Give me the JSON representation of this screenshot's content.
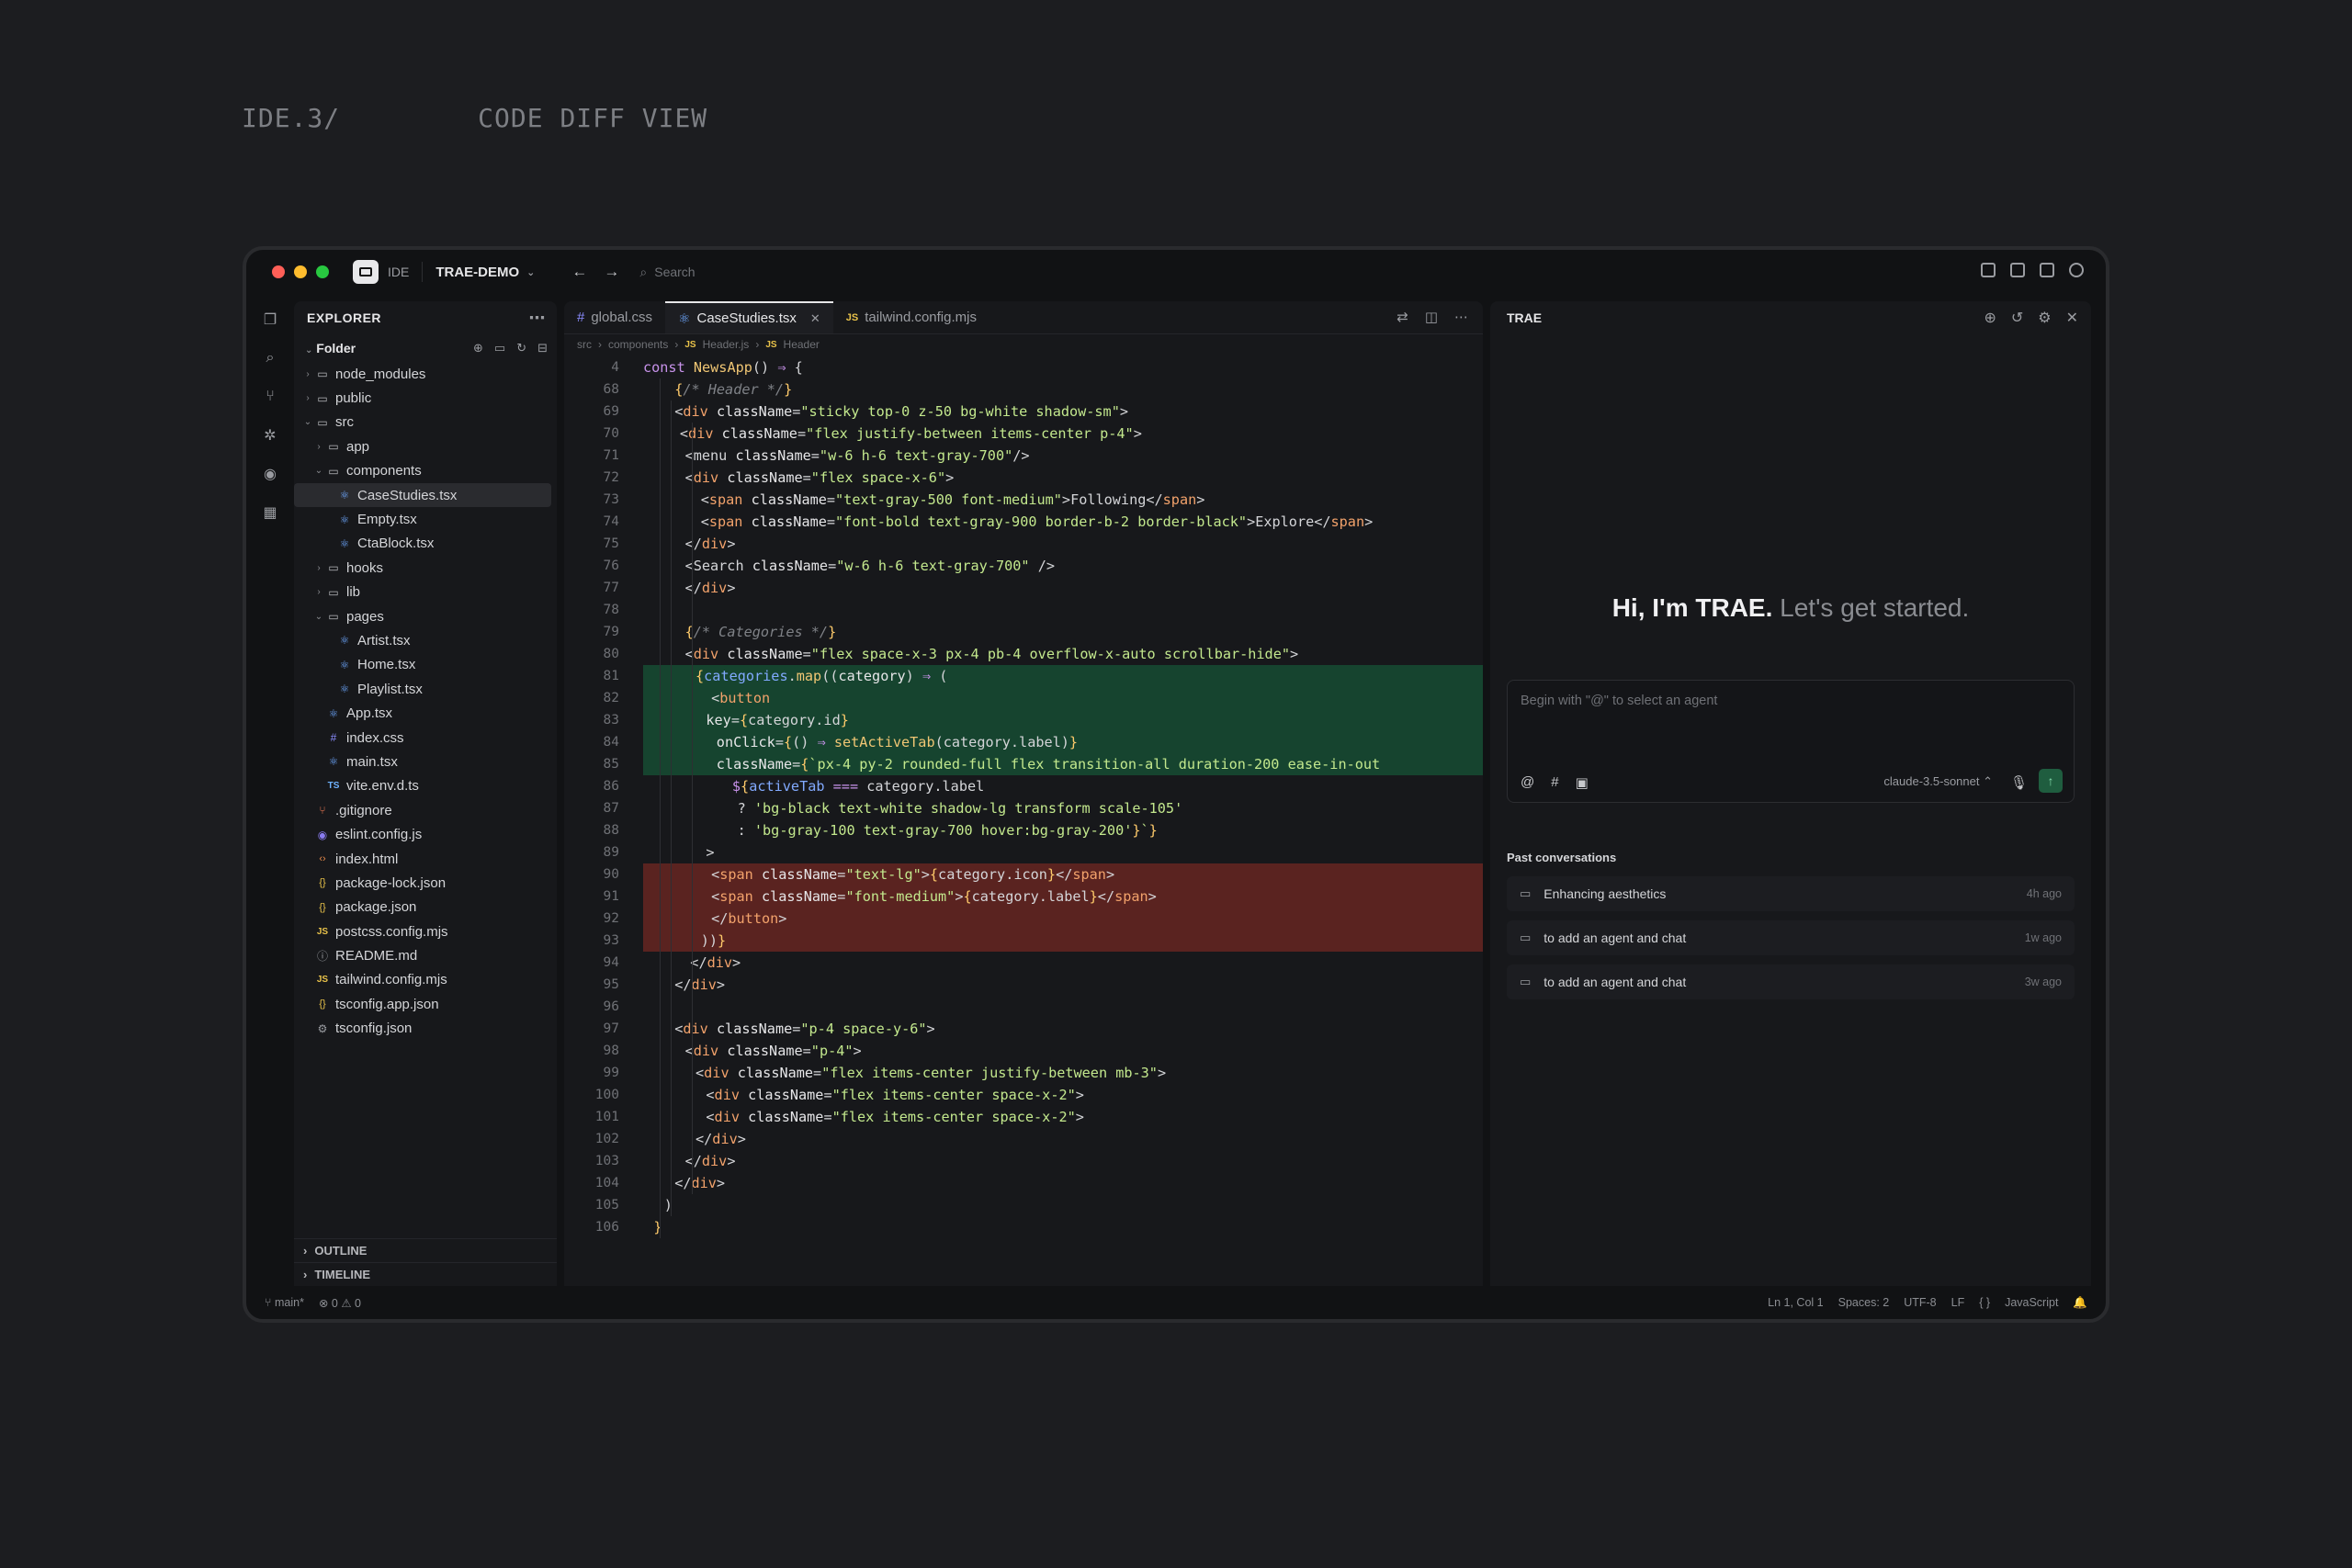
{
  "heading": {
    "label": "IDE.3/",
    "title": "CODE DIFF VIEW"
  },
  "titlebar": {
    "app_badge": "IDE",
    "project": "TRAE-DEMO",
    "search_placeholder": "Search"
  },
  "explorer": {
    "title": "EXPLORER",
    "root": "Folder",
    "items": [
      {
        "name": "node_modules",
        "type": "folder",
        "depth": 0,
        "open": false
      },
      {
        "name": "public",
        "type": "folder",
        "depth": 0,
        "open": false
      },
      {
        "name": "src",
        "type": "folder",
        "depth": 0,
        "open": true
      },
      {
        "name": "app",
        "type": "folder",
        "depth": 1,
        "open": false
      },
      {
        "name": "components",
        "type": "folder",
        "depth": 1,
        "open": true
      },
      {
        "name": "CaseStudies.tsx",
        "type": "react",
        "depth": 2,
        "selected": true
      },
      {
        "name": "Empty.tsx",
        "type": "react",
        "depth": 2
      },
      {
        "name": "CtaBlock.tsx",
        "type": "react",
        "depth": 2
      },
      {
        "name": "hooks",
        "type": "folder",
        "depth": 1,
        "open": false
      },
      {
        "name": "lib",
        "type": "folder",
        "depth": 1,
        "open": false
      },
      {
        "name": "pages",
        "type": "folder",
        "depth": 1,
        "open": true
      },
      {
        "name": "Artist.tsx",
        "type": "react",
        "depth": 2
      },
      {
        "name": "Home.tsx",
        "type": "react",
        "depth": 2
      },
      {
        "name": "Playlist.tsx",
        "type": "react",
        "depth": 2
      },
      {
        "name": "App.tsx",
        "type": "react",
        "depth": 1
      },
      {
        "name": "index.css",
        "type": "css",
        "depth": 1
      },
      {
        "name": "main.tsx",
        "type": "react",
        "depth": 1
      },
      {
        "name": "vite.env.d.ts",
        "type": "ts",
        "depth": 1
      },
      {
        "name": ".gitignore",
        "type": "git",
        "depth": 0
      },
      {
        "name": "eslint.config.js",
        "type": "eslint",
        "depth": 0
      },
      {
        "name": "index.html",
        "type": "html",
        "depth": 0
      },
      {
        "name": "package-lock.json",
        "type": "json",
        "depth": 0
      },
      {
        "name": "package.json",
        "type": "json",
        "depth": 0
      },
      {
        "name": "postcss.config.mjs",
        "type": "js",
        "depth": 0
      },
      {
        "name": "README.md",
        "type": "info",
        "depth": 0
      },
      {
        "name": "tailwind.config.mjs",
        "type": "js",
        "depth": 0
      },
      {
        "name": "tsconfig.app.json",
        "type": "json",
        "depth": 0
      },
      {
        "name": "tsconfig.json",
        "type": "gear",
        "depth": 0
      }
    ],
    "outline": "OUTLINE",
    "timeline": "TIMELINE"
  },
  "editor": {
    "tabs": [
      {
        "label": "global.css",
        "icon": "#",
        "active": false
      },
      {
        "label": "CaseStudies.tsx",
        "icon": "react",
        "active": true
      },
      {
        "label": "tailwind.config.mjs",
        "icon": "JS",
        "active": false
      }
    ],
    "breadcrumbs": [
      "src",
      "components",
      "Header.js",
      "Header"
    ],
    "lines": [
      {
        "n": "4",
        "html": "<span class='k'>const</span> <span class='f'>NewsApp</span><span class='p'>() </span><span class='k'>⇒</span> <span class='p'>{</span>",
        "indent": 0
      },
      {
        "n": "68",
        "html": "<span class='br'>{</span><span class='c'>/* Header */</span><span class='br'>}</span>",
        "indent": 3
      },
      {
        "n": "69",
        "html": "<span class='p'>&lt;</span><span class='t'>div</span> <span class='a'>className</span><span class='p'>=</span><span class='s'>\"sticky top-0 z-50 bg-white shadow-sm\"</span><span class='p'>&gt;</span>",
        "indent": 3
      },
      {
        "n": "70",
        "html": "<span class='p'>&lt;</span><span class='t'>div</span> <span class='a'>className</span><span class='p'>=</span><span class='s'>\"flex justify-between items-center p-4\"</span><span class='p'>&gt;</span>",
        "indent": 3.5
      },
      {
        "n": "71",
        "html": "<span class='p'>&lt;menu</span> <span class='a'>className</span><span class='p'>=</span><span class='s'>\"w-6 h-6 text-gray-700\"</span><span class='p'>/&gt;</span>",
        "indent": 4
      },
      {
        "n": "72",
        "html": "<span class='p'>&lt;</span><span class='t'>div</span> <span class='a'>className</span><span class='p'>=</span><span class='s'>\"flex space-x-6\"</span><span class='p'>&gt;</span>",
        "indent": 4
      },
      {
        "n": "73",
        "html": "<span class='p'>&lt;</span><span class='t'>span</span> <span class='a'>className</span><span class='p'>=</span><span class='s'>\"text-gray-500 font-medium\"</span><span class='p'>&gt;Following&lt;/</span><span class='t'>span</span><span class='p'>&gt;</span>",
        "indent": 5.5
      },
      {
        "n": "74",
        "html": "<span class='p'>&lt;</span><span class='t'>span</span> <span class='a'>className</span><span class='p'>=</span><span class='s'>\"font-bold text-gray-900 border-b-2 border-black\"</span><span class='p'>&gt;Explore&lt;/</span><span class='t'>span</span><span class='p'>&gt;</span>",
        "indent": 5.5
      },
      {
        "n": "75",
        "html": "<span class='p'>&lt;/</span><span class='t'>div</span><span class='p'>&gt;</span>",
        "indent": 4
      },
      {
        "n": "76",
        "html": "<span class='p'>&lt;Search</span> <span class='a'>className</span><span class='p'>=</span><span class='s'>\"w-6 h-6 text-gray-700\"</span> <span class='p'>/&gt;</span>",
        "indent": 4
      },
      {
        "n": "77",
        "html": "<span class='p'>&lt;/</span><span class='t'>div</span><span class='p'>&gt;</span>",
        "indent": 4
      },
      {
        "n": "78",
        "html": "",
        "indent": 0
      },
      {
        "n": "79",
        "html": "<span class='br'>{</span><span class='c'>/* Categories */</span><span class='br'>}</span>",
        "indent": 4
      },
      {
        "n": "80",
        "html": "<span class='p'>&lt;</span><span class='t'>div</span> <span class='a'>className</span><span class='p'>=</span><span class='s'>\"flex space-x-3 px-4 pb-4 overflow-x-auto scrollbar-hide\"</span><span class='p'>&gt;</span>",
        "indent": 4
      },
      {
        "n": "81",
        "html": "<span class='br'>{</span><span class='v'>categories</span><span class='p'>.</span><span class='f'>map</span><span class='p'>((</span><span class='a'>category</span><span class='p'>) </span><span class='k'>⇒</span> <span class='p'>(</span>",
        "indent": 5,
        "diff": "add"
      },
      {
        "n": "82",
        "html": "<span class='p'>&lt;</span><span class='t'>button</span>",
        "indent": 6.5,
        "diff": "add"
      },
      {
        "n": "83",
        "html": "<span class='a'>key</span><span class='p'>=</span><span class='br'>{</span><span class='p'>category.id</span><span class='br'>}</span>",
        "indent": 6,
        "diff": "add"
      },
      {
        "n": "84",
        "html": "<span class='a'>onClick</span><span class='p'>=</span><span class='br'>{</span><span class='p'>() </span><span class='k'>⇒</span> <span class='f'>setActiveTab</span><span class='p'>(category.label)</span><span class='br'>}</span>",
        "indent": 7,
        "diff": "add"
      },
      {
        "n": "85",
        "html": "<span class='a'>className</span><span class='p'>=</span><span class='br'>{</span><span class='s'>`px-4 py-2 rounded-full flex transition-all duration-200 ease-in-out</span>",
        "indent": 7,
        "diff": "add"
      },
      {
        "n": "86",
        "html": "<span class='k'>$</span><span class='br'>{</span><span class='v'>activeTab</span> <span class='k'>===</span> <span class='p'>category.label</span>",
        "indent": 8.5
      },
      {
        "n": "87",
        "html": "<span class='p'>? </span><span class='s'>'bg-black text-white shadow-lg transform scale-105'</span>",
        "indent": 9
      },
      {
        "n": "88",
        "html": "<span class='p'>: </span><span class='s'>'bg-gray-100 text-gray-700 hover:bg-gray-200'</span><span class='br'>}</span><span class='s'>`</span><span class='br'>}</span>",
        "indent": 9
      },
      {
        "n": "89",
        "html": "<span class='p'>&gt;</span>",
        "indent": 6
      },
      {
        "n": "90",
        "html": "<span class='p'>&lt;</span><span class='t'>span</span> <span class='a'>className</span><span class='p'>=</span><span class='s'>\"text-lg\"</span><span class='p'>&gt;</span><span class='br'>{</span><span class='p'>category.icon</span><span class='br'>}</span><span class='p'>&lt;/</span><span class='t'>span</span><span class='p'>&gt;</span>",
        "indent": 6.5,
        "diff": "del"
      },
      {
        "n": "91",
        "html": "<span class='p'>&lt;</span><span class='t'>span</span> <span class='a'>className</span><span class='p'>=</span><span class='s'>\"font-medium\"</span><span class='p'>&gt;</span><span class='br'>{</span><span class='p'>category.label</span><span class='br'>}</span><span class='p'>&lt;/</span><span class='t'>span</span><span class='p'>&gt;</span>",
        "indent": 6.5,
        "diff": "del"
      },
      {
        "n": "92",
        "html": "<span class='p'>&lt;/</span><span class='t'>button</span><span class='p'>&gt;</span>",
        "indent": 6.5,
        "diff": "del"
      },
      {
        "n": "93",
        "html": "<span class='p'>))</span><span class='br'>}</span>",
        "indent": 5.5,
        "diff": "del"
      },
      {
        "n": "94",
        "html": "<span class='p'>&lt;/</span><span class='t'>div</span><span class='p'>&gt;</span>",
        "indent": 4.5
      },
      {
        "n": "95",
        "html": "<span class='p'>&lt;/</span><span class='t'>div</span><span class='p'>&gt;</span>",
        "indent": 3
      },
      {
        "n": "96",
        "html": "",
        "indent": 0
      },
      {
        "n": "97",
        "html": "<span class='p'>&lt;</span><span class='t'>div</span> <span class='a'>className</span><span class='p'>=</span><span class='s'>\"p-4 space-y-6\"</span><span class='p'>&gt;</span>",
        "indent": 3
      },
      {
        "n": "98",
        "html": "<span class='p'>&lt;</span><span class='t'>div</span> <span class='a'>className</span><span class='p'>=</span><span class='s'>\"p-4\"</span><span class='p'>&gt;</span>",
        "indent": 4
      },
      {
        "n": "99",
        "html": "<span class='p'>&lt;</span><span class='t'>div</span> <span class='a'>className</span><span class='p'>=</span><span class='s'>\"flex items-center justify-between mb-3\"</span><span class='p'>&gt;</span>",
        "indent": 5
      },
      {
        "n": "100",
        "html": "<span class='p'>&lt;</span><span class='t'>div</span> <span class='a'>className</span><span class='p'>=</span><span class='s'>\"flex items-center space-x-2\"</span><span class='p'>&gt;</span>",
        "indent": 6
      },
      {
        "n": "101",
        "html": "<span class='p'>&lt;</span><span class='t'>div</span> <span class='a'>className</span><span class='p'>=</span><span class='s'>\"flex items-center space-x-2\"</span><span class='p'>&gt;</span>",
        "indent": 6
      },
      {
        "n": "102",
        "html": "<span class='p'>&lt;/</span><span class='t'>div</span><span class='p'>&gt;</span>",
        "indent": 5
      },
      {
        "n": "103",
        "html": "<span class='p'>&lt;/</span><span class='t'>div</span><span class='p'>&gt;</span>",
        "indent": 4
      },
      {
        "n": "104",
        "html": "<span class='p'>&lt;/</span><span class='t'>div</span><span class='p'>&gt;</span>",
        "indent": 3
      },
      {
        "n": "105",
        "html": "<span class='p'>)</span>",
        "indent": 2
      },
      {
        "n": "106",
        "html": "<span class='br'>}</span>",
        "indent": 1
      }
    ]
  },
  "trae": {
    "title": "TRAE",
    "greeting_bold": "Hi, I'm TRAE.",
    "greeting_dim": "Let's get started.",
    "input_placeholder": "Begin with \"@\" to select an agent",
    "model": "claude-3.5-sonnet",
    "past_title": "Past conversations",
    "conversations": [
      {
        "title": "Enhancing aesthetics",
        "when": "4h ago"
      },
      {
        "title": "to add an agent and chat",
        "when": "1w ago"
      },
      {
        "title": "to add an agent and chat",
        "when": "3w ago"
      }
    ]
  },
  "status": {
    "branch": "main*",
    "problems": "0 ⚠ 0",
    "cursor": "Ln 1, Col 1",
    "spaces": "Spaces: 2",
    "encoding": "UTF-8",
    "eol": "LF",
    "braces": "{ }",
    "language": "JavaScript"
  }
}
